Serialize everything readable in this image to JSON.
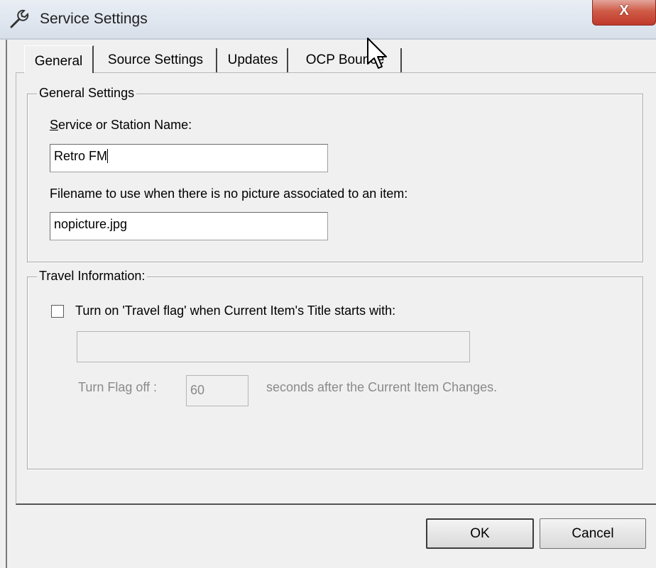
{
  "window": {
    "title": "Service Settings",
    "close_glyph": "X",
    "title_icon": "wrench-icon"
  },
  "tabs": [
    {
      "label": "General",
      "active": true
    },
    {
      "label": "Source Settings",
      "active": false
    },
    {
      "label": "Updates",
      "active": false
    },
    {
      "label": "OCP Bounce",
      "active": false
    }
  ],
  "general_settings": {
    "group_title": "General Settings",
    "service_name_label_accel": "S",
    "service_name_label_rest": "ervice or Station Name:",
    "service_name_value": "Retro FM",
    "picture_label": "Filename to use when there is no picture associated to an item:",
    "picture_value": "nopicture.jpg"
  },
  "travel": {
    "group_title": "Travel Information:",
    "checkbox_label": "Turn on 'Travel flag' when Current Item's Title starts with:",
    "checkbox_checked": false,
    "prefix_value": "",
    "turn_off_label": "Turn Flag off :",
    "seconds_value": "60",
    "seconds_label": "seconds after the Current Item Changes."
  },
  "buttons": {
    "ok": "OK",
    "cancel": "Cancel"
  }
}
